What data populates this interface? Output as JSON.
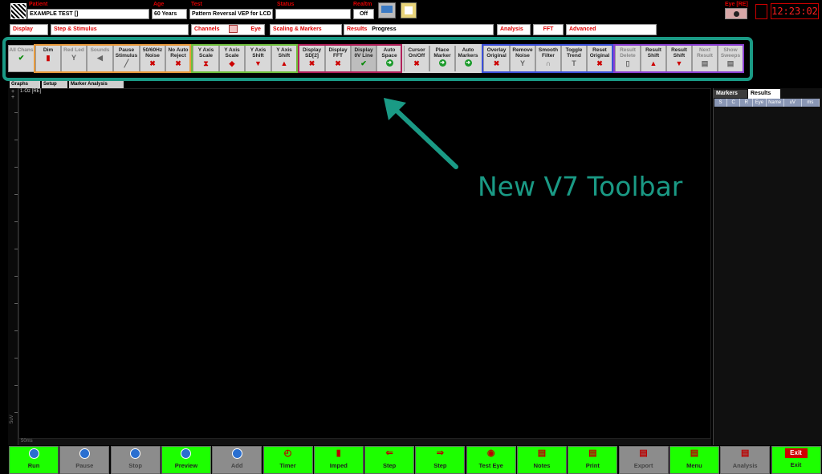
{
  "header": {
    "patient_label": "Patient",
    "patient_value": "EXAMPLE TEST []",
    "age_label": "Age",
    "age_value": "60 Years",
    "test_label": "Test",
    "test_value": "Pattern Reversal VEP for LCD",
    "status_label": "Status",
    "status_value": "",
    "realtime_label": "Realtm",
    "realtime_value": "Off",
    "eye_label": "Eye [RE]",
    "clock": "12:23:02"
  },
  "tabs": {
    "display": "Display",
    "step_stimulus": "Step & Stimulus",
    "channels": "Channels",
    "eye": "Eye",
    "scaling_markers": "Scaling & Markers",
    "results": "Results",
    "progress": "Progress",
    "analysis": "Analysis",
    "fft": "FFT",
    "advanced": "Advanced"
  },
  "toolbar": [
    {
      "label": "All Chans",
      "icon": "✔"
    },
    {
      "label": "Dim",
      "icon": "▮"
    },
    {
      "label": "Red Led",
      "icon": "Y"
    },
    {
      "label": "Sounds",
      "icon": "◀"
    },
    {
      "label": "Pause Stimulus",
      "icon": "╱"
    },
    {
      "label": "50/60Hz Noise",
      "icon": "✖"
    },
    {
      "label": "No Auto Reject",
      "icon": "✖"
    },
    {
      "label": "Y Axis Scale",
      "icon": "⧗"
    },
    {
      "label": "Y Axis Scale",
      "icon": "◆"
    },
    {
      "label": "Y Axis Shift",
      "icon": "▼"
    },
    {
      "label": "Y Axis Shift",
      "icon": "▲"
    },
    {
      "label": "Display SD[2]",
      "icon": "✖"
    },
    {
      "label": "Display FFT",
      "icon": "✖"
    },
    {
      "label": "Display 0V Line",
      "icon": "✔"
    },
    {
      "label": "Auto Space",
      "icon": "➜"
    },
    {
      "label": "Cursor On/Off",
      "icon": "✖"
    },
    {
      "label": "Place Marker",
      "icon": "➜"
    },
    {
      "label": "Auto Markers",
      "icon": "➜"
    },
    {
      "label": "Overlay Original",
      "icon": "✖"
    },
    {
      "label": "Remove Noise",
      "icon": "Y"
    },
    {
      "label": "Smooth Filter",
      "icon": "∩"
    },
    {
      "label": "Toggle Trend",
      "icon": "T"
    },
    {
      "label": "Reset Original",
      "icon": "✖"
    },
    {
      "label": "Result Delete",
      "icon": "▯"
    },
    {
      "label": "Result Shift",
      "icon": "▲"
    },
    {
      "label": "Result Shift",
      "icon": "▼"
    },
    {
      "label": "Next Result",
      "icon": "▤"
    },
    {
      "label": "Show Sweeps",
      "icon": "▤"
    }
  ],
  "subtabs": [
    "Graphs",
    "Setup",
    "Marker Analysis"
  ],
  "graph": {
    "channel": "1-Oz [RE]",
    "time_scale": "50ms",
    "amp_scale": "5uV"
  },
  "right_panel": {
    "tab_markers": "Markers",
    "tab_results": "Results",
    "columns": [
      "S",
      "C",
      "R",
      "Eye",
      "Name",
      "uV",
      "ms"
    ]
  },
  "annotation": {
    "text": "New V7 Toolbar",
    "color": "#1a9a85"
  },
  "bottom_buttons": [
    {
      "label": "Run",
      "icon": "●",
      "state": "green"
    },
    {
      "label": "Pause",
      "icon": "●",
      "state": "gray"
    },
    {
      "label": "Stop",
      "icon": "●",
      "state": "gray"
    },
    {
      "label": "Preview",
      "icon": "●",
      "state": "green"
    },
    {
      "label": "Add",
      "icon": "●",
      "state": "gray"
    },
    {
      "label": "Timer",
      "icon": "◴",
      "state": "green"
    },
    {
      "label": "Imped",
      "icon": "▮",
      "state": "green"
    },
    {
      "label": "Step",
      "icon": "⇐",
      "state": "green"
    },
    {
      "label": "Step",
      "icon": "⇒",
      "state": "green"
    },
    {
      "label": "Test Eye",
      "icon": "◉",
      "state": "green"
    },
    {
      "label": "Notes",
      "icon": "▤",
      "state": "green"
    },
    {
      "label": "Print",
      "icon": "▤",
      "state": "green"
    },
    {
      "label": "Export",
      "icon": "▤",
      "state": "gray"
    },
    {
      "label": "Menu",
      "icon": "▤",
      "state": "green"
    },
    {
      "label": "Analysis",
      "icon": "▤",
      "state": "gray"
    },
    {
      "label": "Exit",
      "icon": "Exit",
      "state": "green"
    }
  ]
}
